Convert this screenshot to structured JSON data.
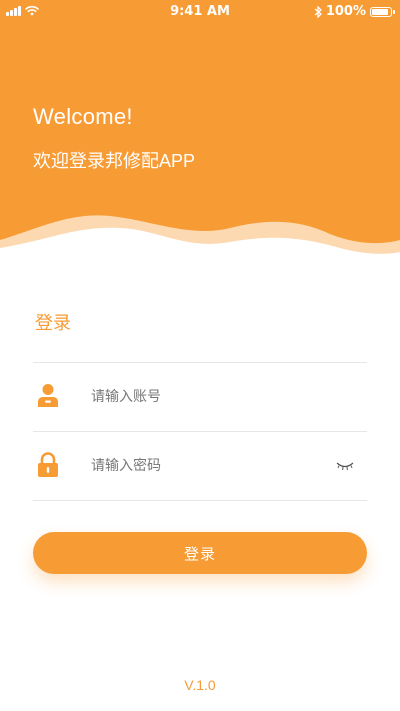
{
  "status_bar": {
    "time": "9:41 AM",
    "battery_percent_label": "100%",
    "battery_level": 1.0,
    "icons": [
      "signal-icon",
      "wifi-icon",
      "bluetooth-icon",
      "battery-icon"
    ]
  },
  "header": {
    "welcome": "Welcome!",
    "subtitle": "欢迎登录邦修配APP",
    "background_color": "#F79B35"
  },
  "form": {
    "title": "登录",
    "account": {
      "icon": "user-icon",
      "placeholder": "请输入账号",
      "value": ""
    },
    "password": {
      "icon": "lock-icon",
      "placeholder": "请输入密码",
      "value": "",
      "toggle_icon": "eye-closed-icon"
    },
    "submit_label": "登录"
  },
  "footer": {
    "version": "V.1.0"
  },
  "colors": {
    "accent": "#F79B35",
    "divider": "#E6E6E6",
    "wave_light": "#FCD9B0"
  }
}
